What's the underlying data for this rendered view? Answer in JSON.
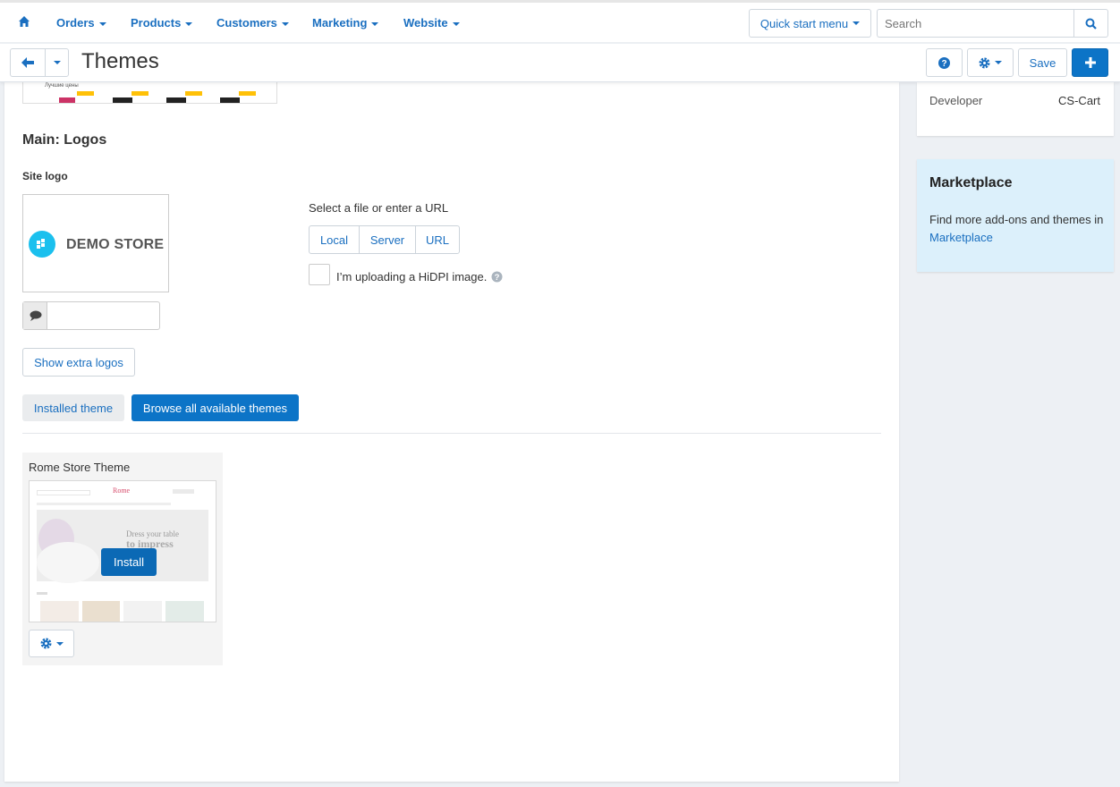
{
  "nav": {
    "items": [
      "Orders",
      "Products",
      "Customers",
      "Marketing",
      "Website"
    ],
    "quick_start": "Quick start menu",
    "search_placeholder": "Search"
  },
  "header": {
    "title": "Themes",
    "save": "Save"
  },
  "logos": {
    "section_title": "Main: Logos",
    "site_logo_label": "Site logo",
    "logo_text": "DEMO STORE",
    "file_prompt": "Select a file or enter a URL",
    "sources": [
      "Local",
      "Server",
      "URL"
    ],
    "hidpi_label": "I’m uploading a HiDPI image.",
    "alt_value": "",
    "show_extra": "Show extra logos"
  },
  "preview_caption": "Лучшие цены",
  "tabs": {
    "installed": "Installed theme",
    "browse": "Browse all available themes"
  },
  "theme_card": {
    "name": "Rome Store Theme",
    "install": "Install",
    "shot_brand": "Rome",
    "shot_tag1": "Dress your table",
    "shot_tag2": "to impress"
  },
  "sidebar": {
    "developer_label": "Developer",
    "developer_value": "CS-Cart",
    "marketplace_title": "Marketplace",
    "marketplace_text": "Find more add-ons and themes in",
    "marketplace_link": "Marketplace"
  },
  "colors": {
    "primary": "#0c74c7",
    "link": "#1a6fc0",
    "marketplace_bg": "#dcf0fb",
    "logo_accent": "#1bc0ee"
  }
}
